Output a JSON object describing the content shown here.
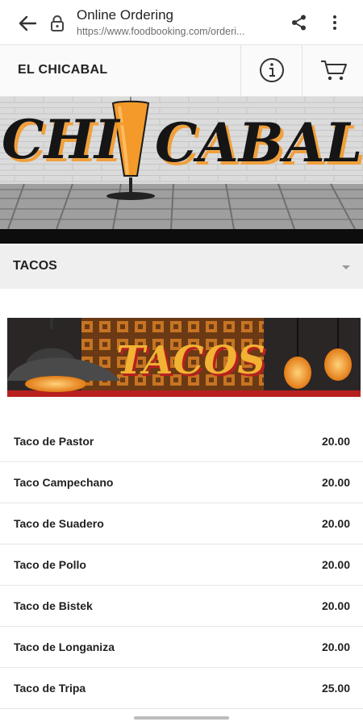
{
  "browser": {
    "title": "Online Ordering",
    "url": "https://www.foodbooking.com/orderi..."
  },
  "header": {
    "restaurant_name": "EL CHICABAL"
  },
  "banner": {
    "logo_text": "CHICABAL"
  },
  "category": {
    "selected": "TACOS",
    "image_text": "TACOS"
  },
  "menu_items": [
    {
      "name": "Taco de Pastor",
      "price": "20.00"
    },
    {
      "name": "Taco Campechano",
      "price": "20.00"
    },
    {
      "name": "Taco de Suadero",
      "price": "20.00"
    },
    {
      "name": "Taco de Pollo",
      "price": "20.00"
    },
    {
      "name": "Taco de Bistek",
      "price": "20.00"
    },
    {
      "name": "Taco de Longaniza",
      "price": "20.00"
    },
    {
      "name": "Taco de Tripa",
      "price": "25.00"
    }
  ],
  "colors": {
    "brand_orange": "#f39a2b",
    "logo_black": "#151515"
  }
}
